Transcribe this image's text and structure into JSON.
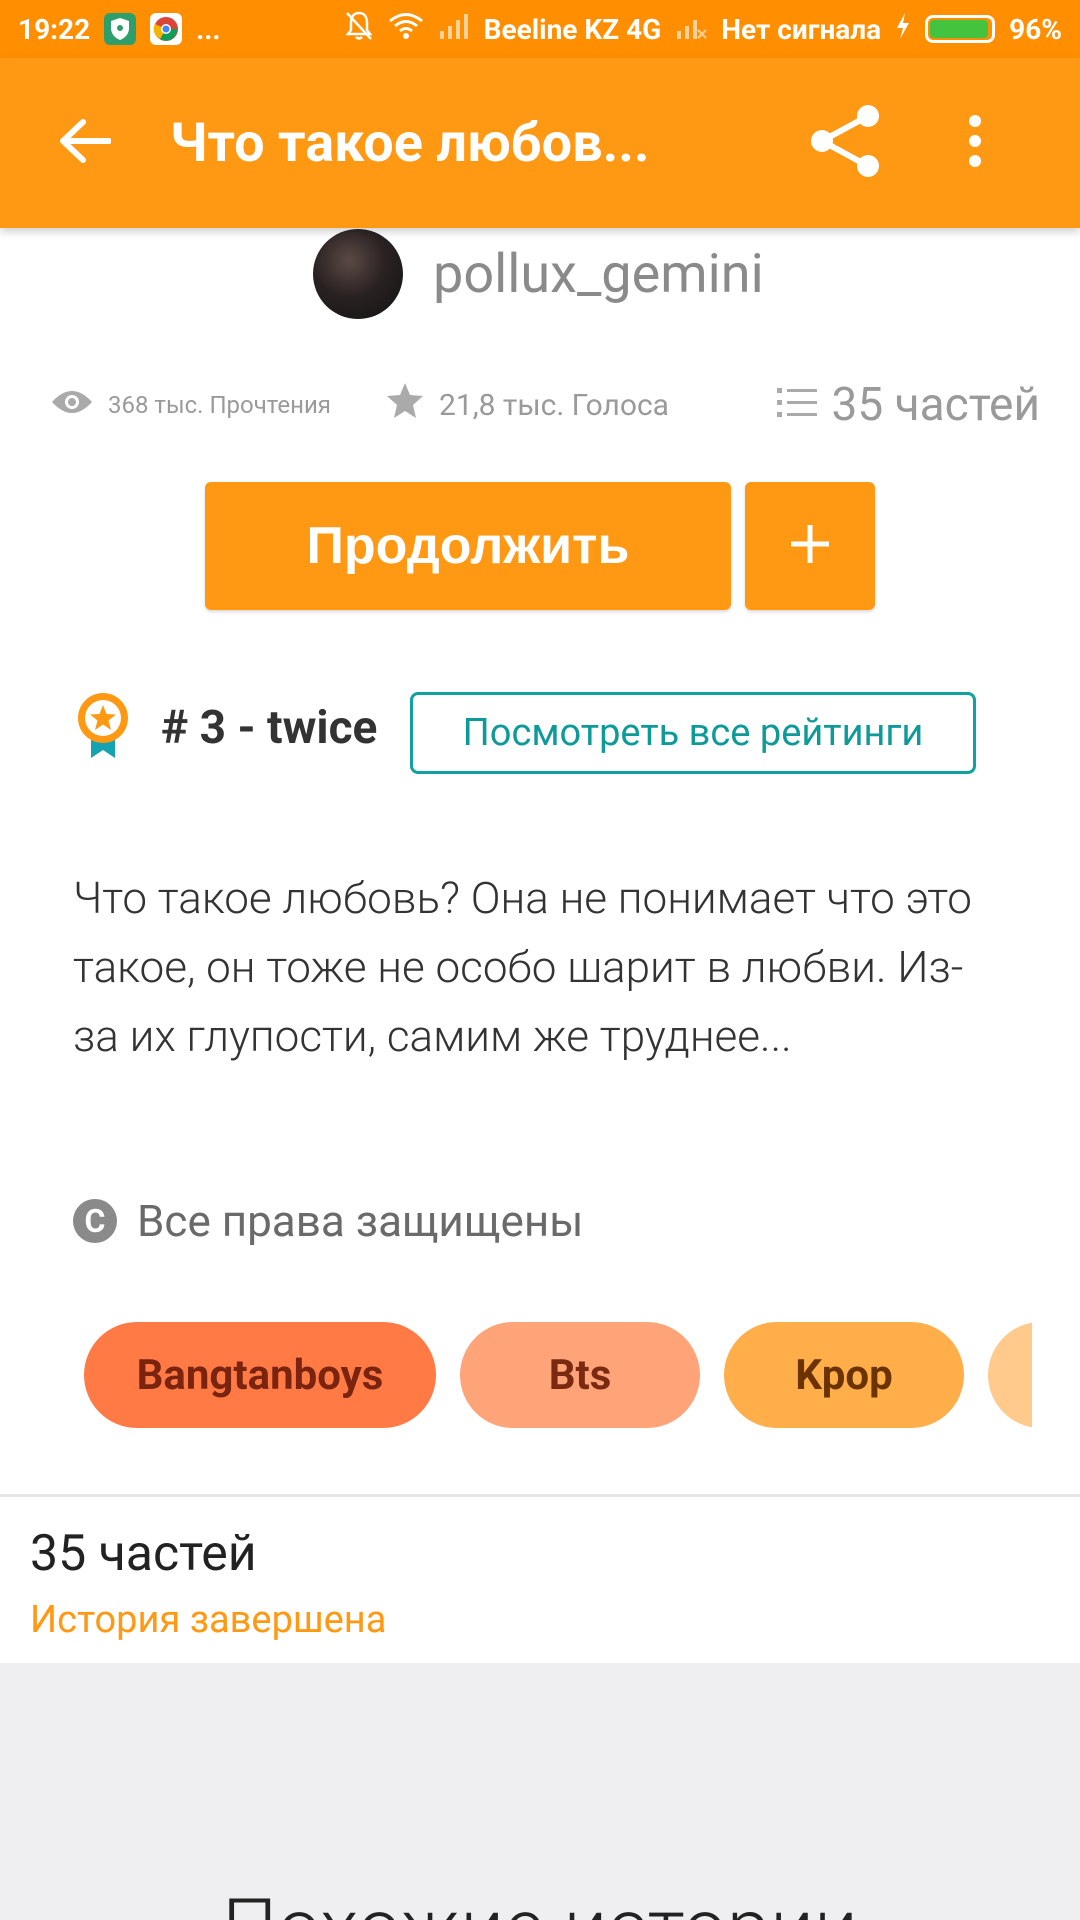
{
  "status_bar": {
    "time": "19:22",
    "overflow": "...",
    "carrier": "Beeline KZ 4G",
    "no_signal": "Нет сигнала",
    "battery": "96%",
    "battery_level": 0.96
  },
  "toolbar": {
    "title": "Что такое любов...",
    "back_icon": "arrow-left-icon",
    "share_icon": "share-icon",
    "more_icon": "more-vertical-icon"
  },
  "author": {
    "name": "pollux_gemini"
  },
  "stats": {
    "reads": "368 тыс. Прочтения",
    "votes": "21,8 тыс. Голоса",
    "parts": "35 частей"
  },
  "actions": {
    "continue_label": "Продолжить",
    "add_label": "+"
  },
  "ranking": {
    "label": "# 3 - twice",
    "view_all": "Посмотреть все рейтинги"
  },
  "description": "Что такое любовь? Она не понимает что это такое, он тоже не особо шарит в любви. Из-за их глупости, самим же труднее...",
  "copyright": "Все права защищены",
  "tags": [
    {
      "label": "Bangtanboys",
      "bg": "#ff7a45",
      "fg": "#7a2410"
    },
    {
      "label": "Bts",
      "bg": "#ffa379",
      "fg": "#7a2a10"
    },
    {
      "label": "Kpop",
      "bg": "#ffae4a",
      "fg": "#6a3300"
    },
    {
      "label": "",
      "bg": "#ffca8c",
      "fg": "#6a3300"
    }
  ],
  "parts_section": {
    "count": "35 частей",
    "status": "История завершена"
  },
  "similar": {
    "title": "Похожие истории"
  },
  "colors": {
    "brand": "#ff9812",
    "status_bar": "#ff8f00",
    "teal": "#12a1a1"
  }
}
